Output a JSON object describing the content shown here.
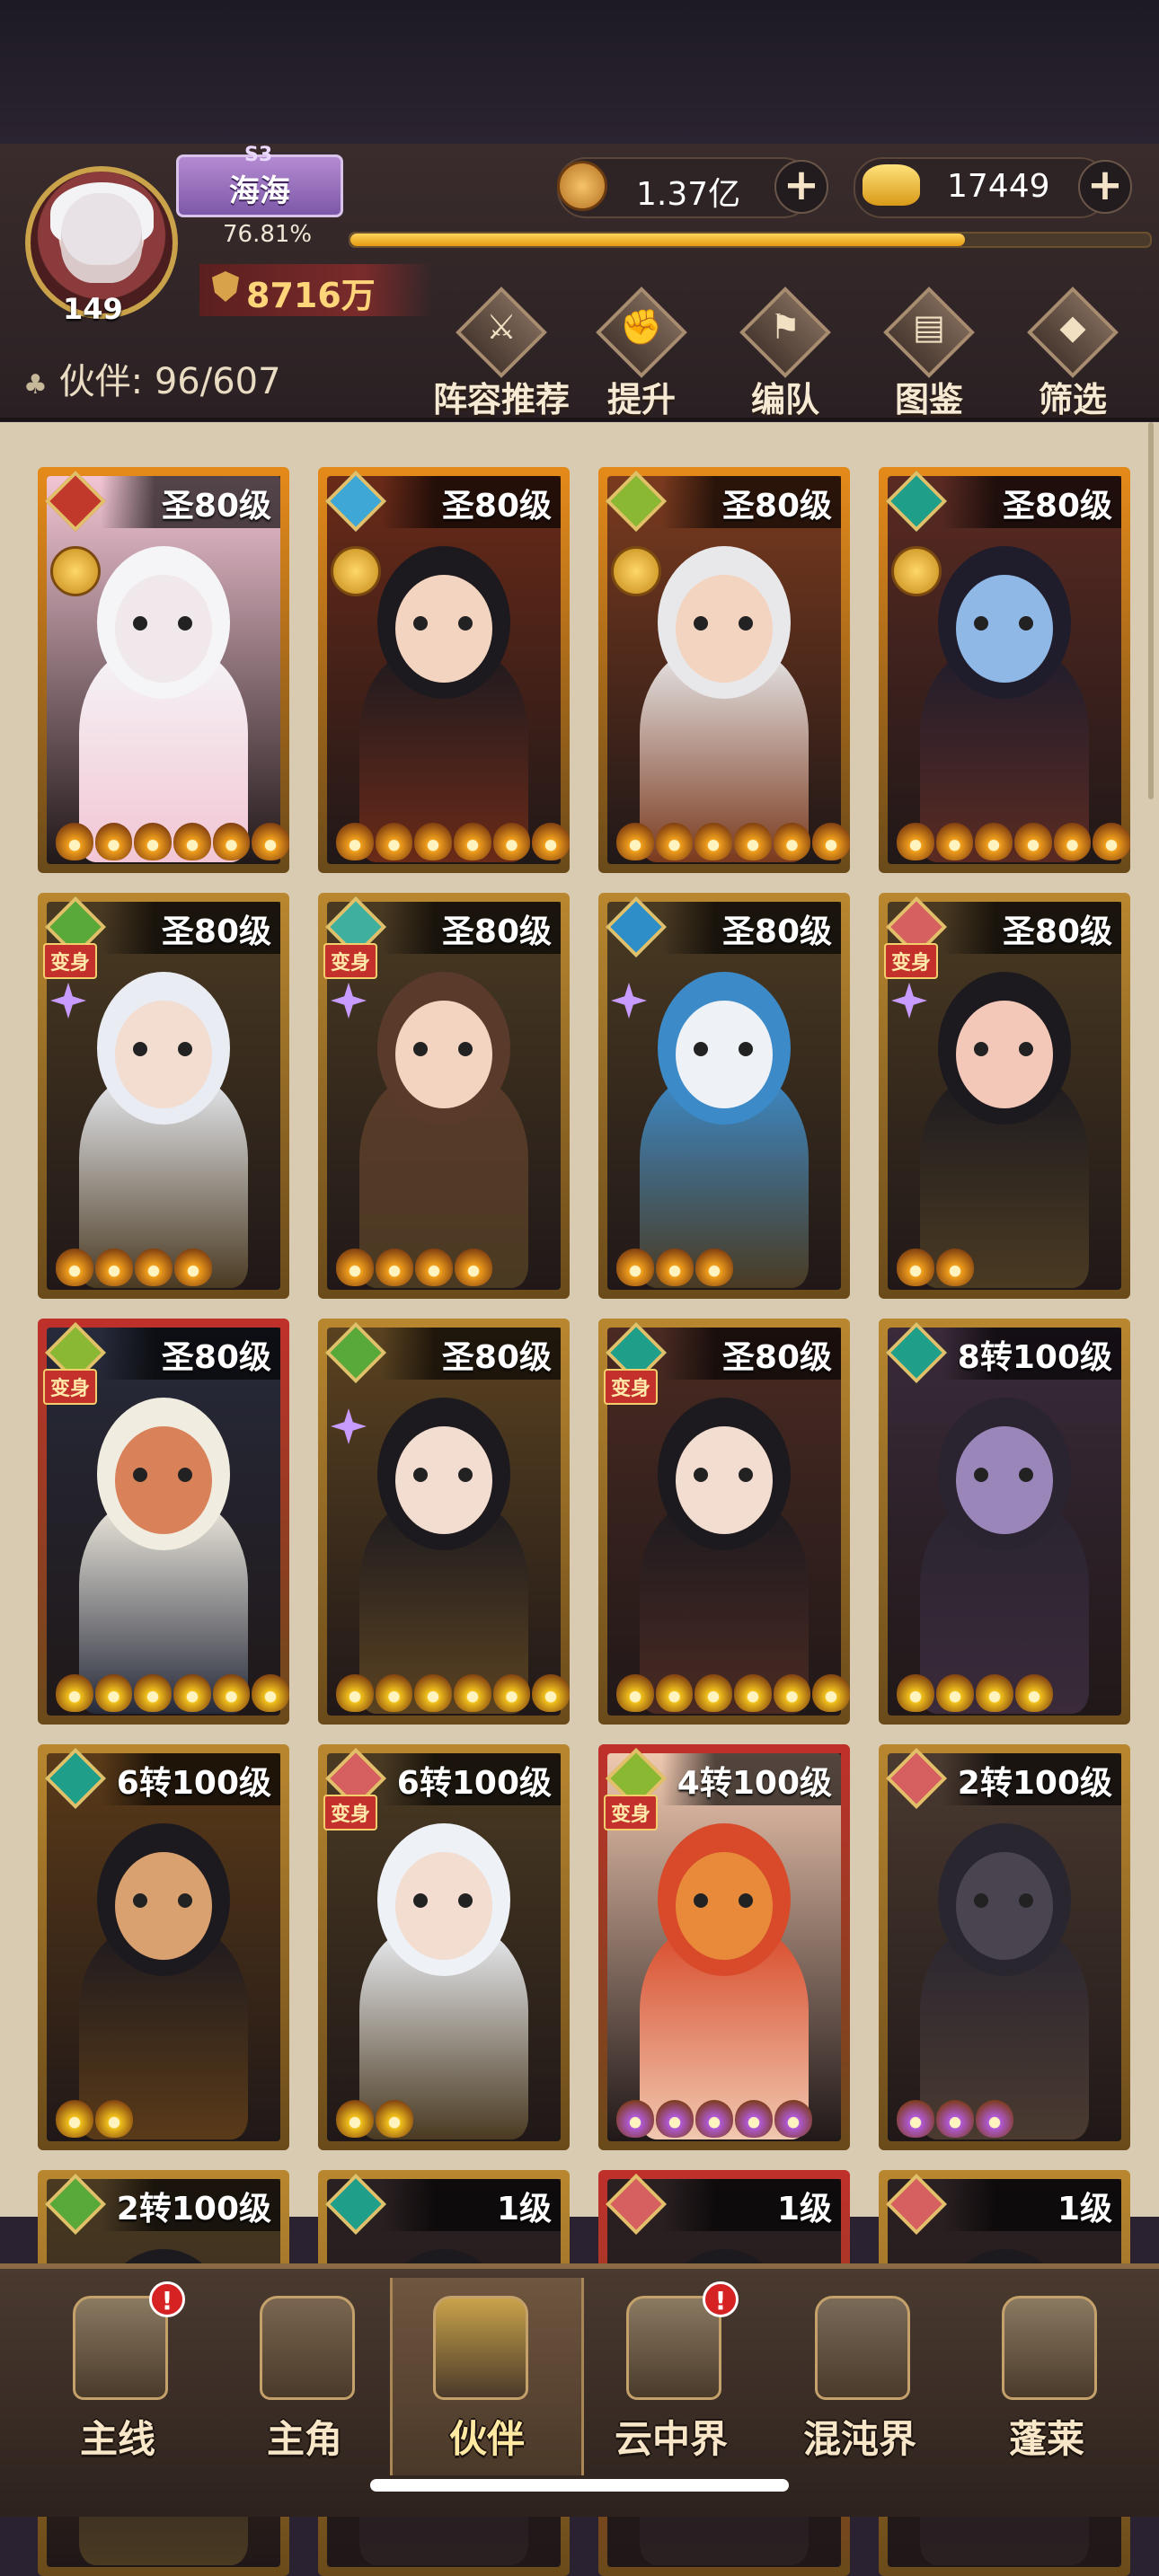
{
  "player": {
    "server": "S3",
    "name": "海海",
    "exp_text": "76.81%",
    "exp_fraction": 0.7681,
    "level": "149",
    "power": "8716万"
  },
  "currency": {
    "copper": "1.37亿",
    "gold": "17449",
    "plus": "+"
  },
  "partners": {
    "label": "伙伴: 96/607"
  },
  "actions": [
    {
      "label": "阵容推荐",
      "icon": "lineup-icon",
      "glyph": "⚔"
    },
    {
      "label": "提升",
      "icon": "upgrade-icon",
      "glyph": "✊"
    },
    {
      "label": "编队",
      "icon": "formation-icon",
      "glyph": "⚑"
    },
    {
      "label": "图鉴",
      "icon": "codex-icon",
      "glyph": "▤"
    },
    {
      "label": "筛选",
      "icon": "filter-icon",
      "glyph": "◆"
    }
  ],
  "cards": [
    {
      "level": "圣80级",
      "elem": "#c0392b",
      "stars": 6,
      "star_color": "#f2a01c",
      "frame": "#e58a1a",
      "bg": "#f2c5d4",
      "skin": "#f0e8ea",
      "hair": "#f5f5f7",
      "transform": "",
      "medal": true,
      "spark": false
    },
    {
      "level": "圣80级",
      "elem": "#3fa7d6",
      "stars": 6,
      "star_color": "#f2a01c",
      "frame": "#e58a1a",
      "bg": "#6a2a18",
      "skin": "#f3d4c0",
      "hair": "#1d1a1f",
      "transform": "",
      "medal": true,
      "spark": false
    },
    {
      "level": "圣80级",
      "elem": "#8ab832",
      "stars": 6,
      "star_color": "#f2a01c",
      "frame": "#e58a1a",
      "bg": "#7a3a1e",
      "skin": "#f3d4c0",
      "hair": "#e8e8ea",
      "transform": "",
      "medal": true,
      "spark": false
    },
    {
      "level": "圣80级",
      "elem": "#1f9e8a",
      "stars": 6,
      "star_color": "#f2a01c",
      "frame": "#e58a1a",
      "bg": "#5a2a22",
      "skin": "#8fb8e6",
      "hair": "#1f1d2c",
      "transform": "",
      "medal": true,
      "spark": false
    },
    {
      "level": "圣80级",
      "elem": "#59a83a",
      "stars": 4,
      "star_color": "#f2a01c",
      "frame": "#b9872f",
      "bg": "#4a3a22",
      "skin": "#f3dcd0",
      "hair": "#e9ecf2",
      "transform": "变身",
      "medal": false,
      "spark": true
    },
    {
      "level": "圣80级",
      "elem": "#3fb0a0",
      "stars": 4,
      "star_color": "#f2a01c",
      "frame": "#b9872f",
      "bg": "#4a3a22",
      "skin": "#f3d4c0",
      "hair": "#5a3a2a",
      "transform": "变身",
      "medal": false,
      "spark": true
    },
    {
      "level": "圣80级",
      "elem": "#2e8fc8",
      "stars": 3,
      "star_color": "#f2a01c",
      "frame": "#b9872f",
      "bg": "#4a3a22",
      "skin": "#eef1f6",
      "hair": "#3c8ac8",
      "transform": "",
      "medal": false,
      "spark": true
    },
    {
      "level": "圣80级",
      "elem": "#d66060",
      "stars": 2,
      "star_color": "#f2a01c",
      "frame": "#b9872f",
      "bg": "#4a3a22",
      "skin": "#f3c8b8",
      "hair": "#1d1a1f",
      "transform": "变身",
      "medal": false,
      "spark": true
    },
    {
      "level": "圣80级",
      "elem": "#8ab832",
      "stars": 6,
      "star_color": "#f2c21c",
      "frame": "#c0302b",
      "bg": "#262a3a",
      "skin": "#d9825a",
      "hair": "#f1ece0",
      "transform": "变身",
      "medal": false,
      "spark": false
    },
    {
      "level": "圣80级",
      "elem": "#59a83a",
      "stars": 6,
      "star_color": "#f2c21c",
      "frame": "#b9872f",
      "bg": "#5a4220",
      "skin": "#f3dcd0",
      "hair": "#1d1a1f",
      "transform": "",
      "medal": false,
      "spark": true
    },
    {
      "level": "圣80级",
      "elem": "#1f9e8a",
      "stars": 6,
      "star_color": "#f2c21c",
      "frame": "#b9872f",
      "bg": "#4a2a22",
      "skin": "#f3dcd0",
      "hair": "#1d1a1f",
      "transform": "变身",
      "medal": false,
      "spark": false
    },
    {
      "level": "8转100级",
      "elem": "#1f9e8a",
      "stars": 4,
      "star_color": "#f2c21c",
      "frame": "#b9872f",
      "bg": "#3a2a3a",
      "skin": "#9a86b8",
      "hair": "#2a2430",
      "transform": "",
      "medal": false,
      "spark": false
    },
    {
      "level": "6转100级",
      "elem": "#1f9e8a",
      "stars": 2,
      "star_color": "#f2c21c",
      "frame": "#b9872f",
      "bg": "#5a3a18",
      "skin": "#d9a070",
      "hair": "#1d1a1f",
      "transform": "",
      "medal": false,
      "spark": false
    },
    {
      "level": "6转100级",
      "elem": "#d66060",
      "stars": 2,
      "star_color": "#f2c21c",
      "frame": "#b9872f",
      "bg": "#4a3a22",
      "skin": "#f3dcd0",
      "hair": "#eef1f6",
      "transform": "变身",
      "medal": false,
      "spark": false
    },
    {
      "level": "4转100级",
      "elem": "#8ab832",
      "stars": 5,
      "star_color": "#b05ad8",
      "frame": "#c0302b",
      "bg": "#f0c8b0",
      "skin": "#e88a3a",
      "hair": "#d84a2a",
      "transform": "变身",
      "medal": false,
      "spark": false
    },
    {
      "level": "2转100级",
      "elem": "#d66060",
      "stars": 3,
      "star_color": "#b05ad8",
      "frame": "#b9872f",
      "bg": "#4a3a30",
      "skin": "#4a4450",
      "hair": "#2a2630",
      "transform": "",
      "medal": false,
      "spark": false
    },
    {
      "level": "2转100级",
      "elem": "#59a83a",
      "stars": 0,
      "star_color": "#f2c21c",
      "frame": "#b9872f",
      "bg": "#4a3a22",
      "skin": "#f3dcd0",
      "hair": "#1d1a1f",
      "transform": "",
      "medal": false,
      "spark": false
    },
    {
      "level": "1级",
      "elem": "#1f9e8a",
      "stars": 0,
      "star_color": "#f2c21c",
      "frame": "#b9872f",
      "bg": "#2a2022",
      "skin": "#f3dcd0",
      "hair": "#1d1a1f",
      "transform": "",
      "medal": false,
      "spark": false
    },
    {
      "level": "1级",
      "elem": "#d66060",
      "stars": 0,
      "star_color": "#f2c21c",
      "frame": "#c0302b",
      "bg": "#2a2022",
      "skin": "#f3dcd0",
      "hair": "#1d1a1f",
      "transform": "",
      "medal": false,
      "spark": false
    },
    {
      "level": "1级",
      "elem": "#d66060",
      "stars": 0,
      "star_color": "#f2c21c",
      "frame": "#b9872f",
      "bg": "#2a2022",
      "skin": "#f3dcd0",
      "hair": "#1d1a1f",
      "transform": "",
      "medal": false,
      "spark": false
    }
  ],
  "nav": [
    {
      "label": "主线",
      "icon": "main-quest-icon",
      "badge": "!",
      "active": false,
      "color": "#8a7a62"
    },
    {
      "label": "主角",
      "icon": "hero-icon",
      "badge": "",
      "active": false,
      "color": "#7a6650"
    },
    {
      "label": "伙伴",
      "icon": "partner-icon",
      "badge": "",
      "active": true,
      "color": "#c9a24a"
    },
    {
      "label": "云中界",
      "icon": "cloud-realm-icon",
      "badge": "!",
      "active": false,
      "color": "#8a7a62"
    },
    {
      "label": "混沌界",
      "icon": "chaos-realm-icon",
      "badge": "",
      "active": false,
      "color": "#7a6a58"
    },
    {
      "label": "蓬莱",
      "icon": "penglai-icon",
      "badge": "",
      "active": false,
      "color": "#8a7a62"
    }
  ]
}
